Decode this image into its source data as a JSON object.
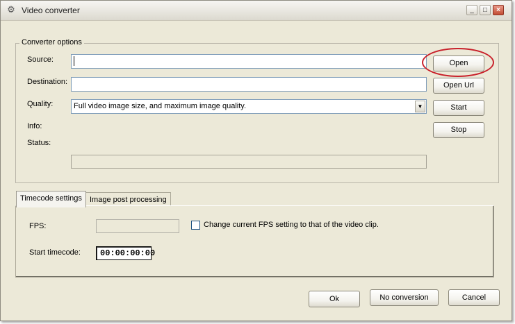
{
  "window": {
    "title": "Video converter",
    "controls": {
      "minimize": "_",
      "maximize": "□",
      "close": "×"
    }
  },
  "converter_options": {
    "legend": "Converter options",
    "source": {
      "label": "Source:",
      "value": ""
    },
    "destination": {
      "label": "Destination:",
      "value": ""
    },
    "quality": {
      "label": "Quality:",
      "selected": "Full video image size, and maximum image quality."
    },
    "info": {
      "label": "Info:",
      "value": ""
    },
    "status": {
      "label": "Status:",
      "value": ""
    },
    "progress_percent": 0
  },
  "side_buttons": {
    "open": "Open",
    "open_url": "Open Url",
    "start": "Start",
    "stop": "Stop"
  },
  "tabs": {
    "items": [
      "Timecode settings",
      "Image post processing"
    ],
    "active": "Timecode settings"
  },
  "timecode_settings": {
    "fps_label": "FPS:",
    "fps_value": "",
    "change_fps_checkbox_label": "Change current FPS setting to that of the video clip.",
    "change_fps_checked": false,
    "start_timecode_label": "Start timecode:",
    "start_timecode_value": "00:00:00:00"
  },
  "footer_buttons": {
    "ok": "Ok",
    "no_conversion": "No conversion",
    "cancel": "Cancel"
  },
  "colors": {
    "window_bg": "#ece9d8",
    "highlight_ring": "#c8202a",
    "input_border": "#7f9db9"
  },
  "icons": {
    "app": "gear-icon",
    "combo_arrow": "chevron-down-icon"
  }
}
